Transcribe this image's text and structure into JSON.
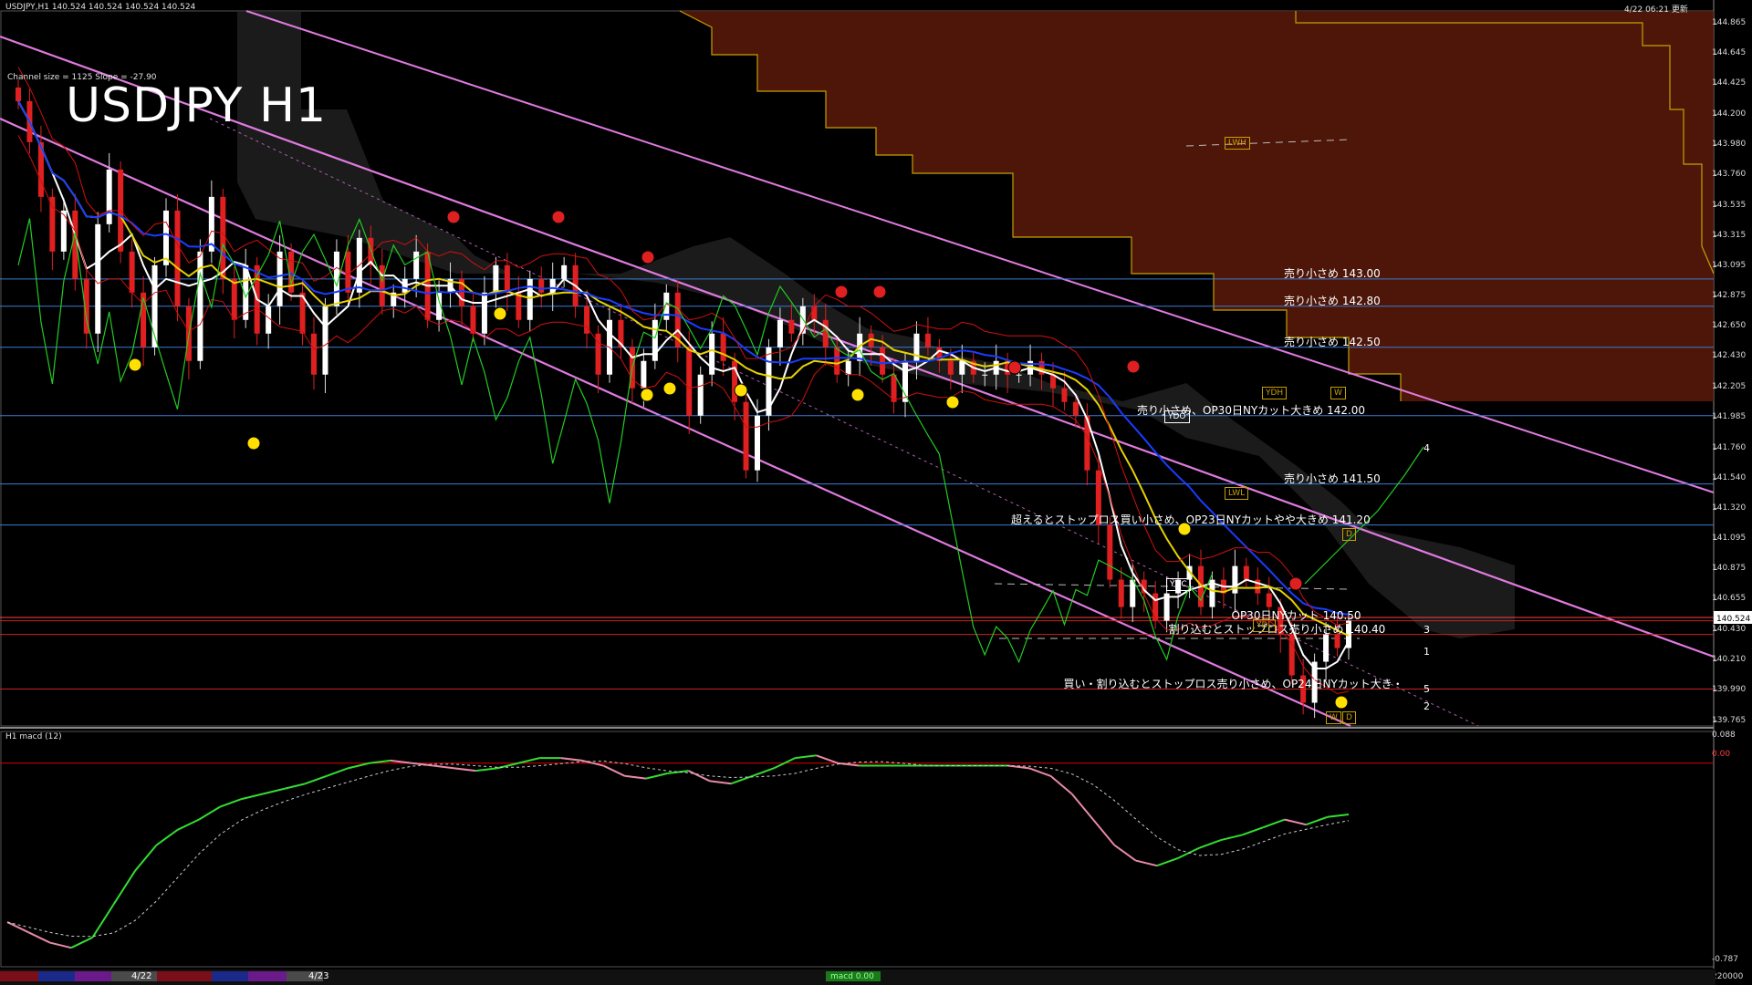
{
  "header": {
    "symbol_line": "USDJPY,H1  140.524 140.524 140.524 140.524",
    "timestamp": "4/22 06:21 更新",
    "channel_info": "Channel size = 1125 Slope = -27.90",
    "big_title": "USDJPY H1"
  },
  "sub_panel": {
    "title": "H1  macd (12)",
    "scale_top": "0.088",
    "scale_zero": "0.00",
    "scale_bottom": "-0.787",
    "bottom_right": "220000"
  },
  "bottom_bar": {
    "date_labels": [
      "4/22",
      "4/23"
    ],
    "green_label": "macd 0.00"
  },
  "price_label_current": "140.524",
  "price_labels": [
    {
      "value": 144.865,
      "text": "144.865"
    },
    {
      "value": 144.645,
      "text": "144.645"
    },
    {
      "value": 144.425,
      "text": "144.425"
    },
    {
      "value": 144.2,
      "text": "144.200"
    },
    {
      "value": 143.98,
      "text": "143.980"
    },
    {
      "value": 143.76,
      "text": "143.760"
    },
    {
      "value": 143.535,
      "text": "143.535"
    },
    {
      "value": 143.315,
      "text": "143.315"
    },
    {
      "value": 143.095,
      "text": "143.095"
    },
    {
      "value": 142.875,
      "text": "142.875"
    },
    {
      "value": 142.65,
      "text": "142.650"
    },
    {
      "value": 142.43,
      "text": "142.430"
    },
    {
      "value": 142.205,
      "text": "142.205"
    },
    {
      "value": 141.985,
      "text": "141.985"
    },
    {
      "value": 141.76,
      "text": "141.760"
    },
    {
      "value": 141.54,
      "text": "141.540"
    },
    {
      "value": 141.32,
      "text": "141.320"
    },
    {
      "value": 141.095,
      "text": "141.095"
    },
    {
      "value": 140.875,
      "text": "140.875"
    },
    {
      "value": 140.655,
      "text": "140.655"
    },
    {
      "value": 140.43,
      "text": "140.430"
    },
    {
      "value": 140.21,
      "text": "140.210"
    },
    {
      "value": 139.99,
      "text": "139.990"
    },
    {
      "value": 139.765,
      "text": "139.765"
    }
  ],
  "levels": [
    {
      "value": 143.0,
      "text": "売り小さめ 143.00",
      "color": "#3a7bd5"
    },
    {
      "value": 142.8,
      "text": "売り小さめ 142.80",
      "color": "#3a7bd5"
    },
    {
      "value": 142.5,
      "text": "売り小さめ 142.50",
      "color": "#3a7bd5"
    },
    {
      "value": 142.0,
      "text": "売り小さめ、OP30日NYカット大きめ 142.00",
      "color": "#3a7bd5"
    },
    {
      "value": 141.5,
      "text": "売り小さめ 141.50",
      "color": "#3a7bd5"
    },
    {
      "value": 141.2,
      "text": "超えるとストップロス買い小さめ、OP23日NYカットやや大きめ 141.20",
      "color": "#3a7bd5"
    },
    {
      "value": 140.5,
      "text": "OP30日NYカット 140.50",
      "color": "#cc2222"
    },
    {
      "value": 140.4,
      "text": "割り込むとストップロス売り小さめ 140.40",
      "color": "#cc2222"
    },
    {
      "value": 140.0,
      "text": "買い・割り込むとストップロス売り小さめ、OP24日NYカット大き・",
      "color": "#cc2222"
    }
  ],
  "boxes": [
    {
      "text": "LWH",
      "color": "#c8a000",
      "price": 143.98
    },
    {
      "text": "YDH",
      "color": "#c8a000",
      "price": 142.15
    },
    {
      "text": "W",
      "color": "#c8a000",
      "price": 142.15
    },
    {
      "text": "YDO",
      "color": "#ffffff",
      "price": 141.98
    },
    {
      "text": "LWL",
      "color": "#c8a000",
      "price": 141.42
    },
    {
      "text": "D",
      "color": "#c8a000",
      "price": 141.12
    },
    {
      "text": "YDC",
      "color": "#ffffff",
      "price": 140.75
    },
    {
      "text": "YDL",
      "color": "#c8a000",
      "price": 140.45
    },
    {
      "text": "W",
      "color": "#c8a000",
      "price": 139.78
    },
    {
      "text": "D",
      "color": "#c8a000",
      "price": 139.78
    }
  ],
  "right_numbers": [
    {
      "text": "4",
      "price": 141.76
    },
    {
      "text": "3",
      "price": 140.43
    },
    {
      "text": "1",
      "price": 140.27
    },
    {
      "text": "5",
      "price": 140.0
    },
    {
      "text": "2",
      "price": 139.87
    }
  ],
  "chart_data": {
    "type": "candlestick",
    "title": "USDJPY H1",
    "ylim": [
      139.73,
      144.96
    ],
    "macd_ylim": [
      -0.787,
      0.088
    ],
    "closes": [
      144.3,
      144.0,
      143.6,
      143.2,
      143.5,
      143.0,
      142.6,
      143.4,
      143.8,
      143.2,
      142.9,
      142.5,
      143.1,
      143.5,
      142.8,
      142.4,
      143.2,
      143.6,
      143.0,
      142.7,
      143.1,
      142.6,
      142.8,
      143.2,
      142.9,
      142.6,
      142.3,
      142.8,
      143.2,
      142.9,
      143.3,
      143.1,
      142.8,
      142.9,
      143.0,
      143.2,
      142.7,
      142.9,
      143.0,
      142.8,
      142.6,
      142.9,
      143.1,
      142.9,
      142.7,
      143.0,
      142.9,
      143.0,
      143.1,
      142.8,
      142.6,
      142.3,
      142.7,
      142.5,
      142.2,
      142.4,
      142.7,
      142.9,
      142.5,
      142.0,
      142.3,
      142.6,
      142.4,
      142.1,
      141.6,
      142.0,
      142.5,
      142.7,
      142.6,
      142.8,
      142.7,
      142.5,
      142.3,
      142.4,
      142.6,
      142.5,
      142.3,
      142.1,
      142.4,
      142.6,
      142.5,
      142.4,
      142.3,
      142.4,
      142.3,
      142.3,
      142.4,
      142.3,
      142.3,
      142.4,
      142.3,
      142.2,
      142.1,
      142.0,
      141.6,
      141.2,
      140.8,
      140.6,
      140.8,
      140.7,
      140.5,
      140.7,
      140.8,
      140.9,
      140.6,
      140.8,
      140.7,
      140.9,
      140.8,
      140.7,
      140.6,
      140.4,
      140.1,
      139.9,
      140.2,
      140.4,
      140.3,
      140.5
    ],
    "macd": [
      -0.62,
      -0.66,
      -0.7,
      -0.72,
      -0.68,
      -0.55,
      -0.42,
      -0.32,
      -0.26,
      -0.22,
      -0.17,
      -0.14,
      -0.12,
      -0.1,
      -0.08,
      -0.05,
      -0.02,
      0.0,
      0.01,
      0.0,
      -0.01,
      -0.02,
      -0.03,
      -0.02,
      0.0,
      0.02,
      0.02,
      0.01,
      -0.01,
      -0.05,
      -0.06,
      -0.04,
      -0.03,
      -0.07,
      -0.08,
      -0.05,
      -0.02,
      0.02,
      0.03,
      0.0,
      -0.01,
      -0.01,
      -0.01,
      -0.01,
      -0.01,
      -0.01,
      -0.01,
      -0.01,
      -0.02,
      -0.05,
      -0.12,
      -0.22,
      -0.32,
      -0.38,
      -0.4,
      -0.37,
      -0.33,
      -0.3,
      -0.28,
      -0.25,
      -0.22,
      -0.24,
      -0.21,
      -0.2
    ]
  }
}
